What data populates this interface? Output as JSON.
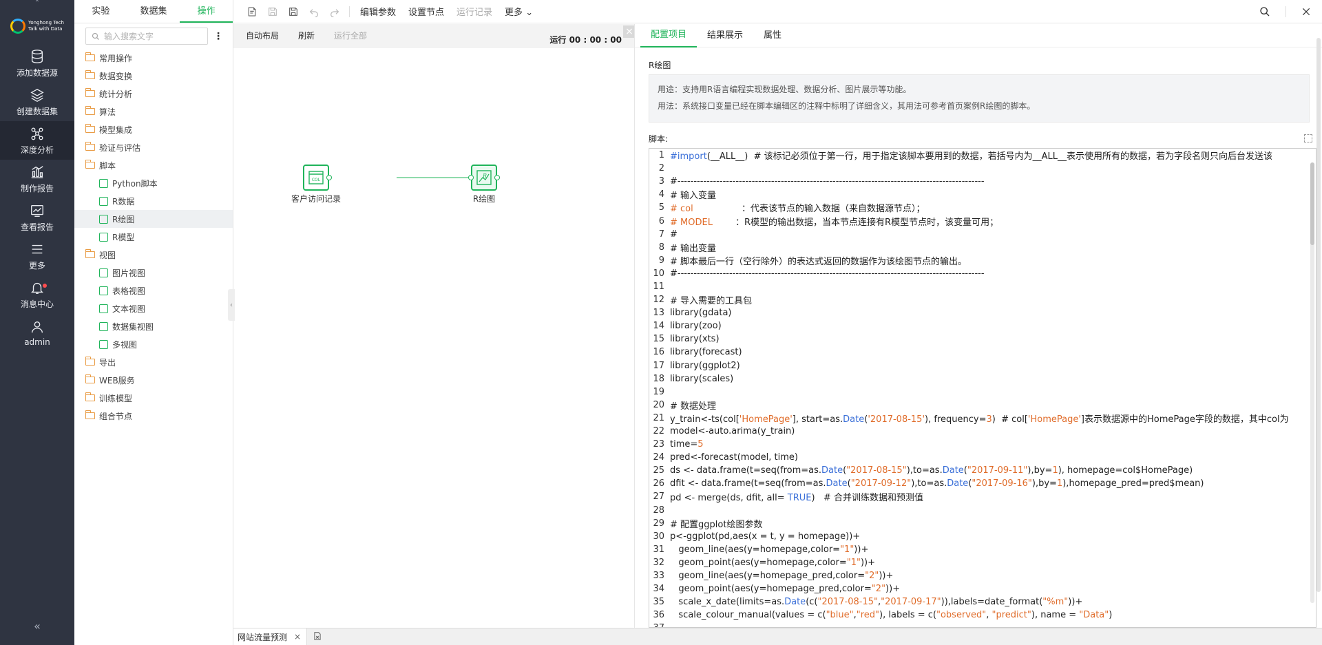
{
  "nav": {
    "items": [
      {
        "label": "添加数据源",
        "icon": "database-icon"
      },
      {
        "label": "创建数据集",
        "icon": "layers-icon"
      },
      {
        "label": "深度分析",
        "icon": "network-icon"
      },
      {
        "label": "制作报告",
        "icon": "bar-chart-icon"
      },
      {
        "label": "查看报告",
        "icon": "line-chart-icon"
      },
      {
        "label": "更多",
        "icon": "menu-icon"
      },
      {
        "label": "消息中心",
        "icon": "bell-icon"
      },
      {
        "label": "admin",
        "icon": "user-icon"
      }
    ],
    "brand_line1": "Yonghong Tech",
    "brand_line2": "Talk with Data"
  },
  "ops": {
    "tabs": [
      "实验",
      "数据集",
      "操作"
    ],
    "search_placeholder": "输入搜索文字",
    "tree": [
      {
        "label": "常用操作",
        "type": "folder"
      },
      {
        "label": "数据变换",
        "type": "folder"
      },
      {
        "label": "统计分析",
        "type": "folder"
      },
      {
        "label": "算法",
        "type": "folder"
      },
      {
        "label": "模型集成",
        "type": "folder"
      },
      {
        "label": "验证与评估",
        "type": "folder"
      },
      {
        "label": "脚本",
        "type": "folder"
      },
      {
        "label": "Python脚本",
        "type": "node"
      },
      {
        "label": "R数据",
        "type": "node"
      },
      {
        "label": "R绘图",
        "type": "node"
      },
      {
        "label": "R模型",
        "type": "node"
      },
      {
        "label": "视图",
        "type": "folder"
      },
      {
        "label": "图片视图",
        "type": "node"
      },
      {
        "label": "表格视图",
        "type": "node"
      },
      {
        "label": "文本视图",
        "type": "node"
      },
      {
        "label": "数据集视图",
        "type": "node"
      },
      {
        "label": "多视图",
        "type": "node"
      },
      {
        "label": "导出",
        "type": "folder"
      },
      {
        "label": "WEB服务",
        "type": "folder"
      },
      {
        "label": "训练模型",
        "type": "folder"
      },
      {
        "label": "组合节点",
        "type": "folder"
      }
    ]
  },
  "toolbar": {
    "edit_params": "编辑参数",
    "set_node": "设置节点",
    "run_log": "运行记录",
    "more": "更多"
  },
  "canvas": {
    "auto_layout": "自动布局",
    "refresh": "刷新",
    "run_all": "运行全部",
    "run_time": "运行 00 : 00 : 00",
    "node1_label": "客户访问记录",
    "node1_icon_text": "COL",
    "node2_label": "R绘图",
    "node2_icon_text": "R"
  },
  "bottom": {
    "tab_label": "网站流量预测"
  },
  "right": {
    "tabs": [
      "配置项目",
      "结果展示",
      "属性"
    ],
    "section_title": "R绘图",
    "usage1": "用途：支持用R语言编程实现数据处理、数据分析、图片展示等功能。",
    "usage2": "用法：系统接口变量已经在脚本编辑区的注释中标明了详细含义，其用法可参考首页案例R绘图的脚本。",
    "script_label": "脚本:"
  },
  "code_lines": [
    [
      [
        "kw",
        "#import"
      ],
      [
        "t",
        "(__ALL__)  # 该标记必须位于第一行，用于指定该脚本要用到的数据，若括号内为__ALL__表示使用所有的数据，若为字段名则只向后台发送该"
      ]
    ],
    [],
    [
      [
        "t",
        "#-----------------------------------------------------------------------------------------------"
      ]
    ],
    [
      [
        "t",
        "# 输入变量"
      ]
    ],
    [
      [
        "str",
        "# col"
      ],
      [
        "t",
        "                 ：代表该节点的输入数据（来自数据源节点）；"
      ]
    ],
    [
      [
        "str",
        "# MODEL"
      ],
      [
        "t",
        "        ：R模型的输出数据，当本节点连接有R模型节点时，该变量可用；"
      ]
    ],
    [
      [
        "t",
        "#"
      ]
    ],
    [
      [
        "t",
        "# 输出变量"
      ]
    ],
    [
      [
        "t",
        "# 脚本最后一行（空行除外）的表达式返回的数据作为该绘图节点的输出。"
      ]
    ],
    [
      [
        "t",
        "#-----------------------------------------------------------------------------------------------"
      ]
    ],
    [],
    [
      [
        "t",
        "# 导入需要的工具包"
      ]
    ],
    [
      [
        "t",
        "library(gdata)"
      ]
    ],
    [
      [
        "t",
        "library(zoo)"
      ]
    ],
    [
      [
        "t",
        "library(xts)"
      ]
    ],
    [
      [
        "t",
        "library(forecast)"
      ]
    ],
    [
      [
        "t",
        "library(ggplot2)"
      ]
    ],
    [
      [
        "t",
        "library(scales)"
      ]
    ],
    [],
    [
      [
        "t",
        "# 数据处理"
      ]
    ],
    [
      [
        "t",
        "y_train<-ts(col["
      ],
      [
        "str",
        "'HomePage'"
      ],
      [
        "t",
        "], start=as."
      ],
      [
        "kw",
        "Date"
      ],
      [
        "t",
        "("
      ],
      [
        "str",
        "'2017-08-15'"
      ],
      [
        "t",
        "), frequency="
      ],
      [
        "num",
        "3"
      ],
      [
        "t",
        ")  # col["
      ],
      [
        "str",
        "'HomePage'"
      ],
      [
        "t",
        "]表示数据源中的HomePage字段的数据，其中col为"
      ]
    ],
    [
      [
        "t",
        "model<-auto.arima(y_train)"
      ]
    ],
    [
      [
        "t",
        "time="
      ],
      [
        "num",
        "5"
      ]
    ],
    [
      [
        "t",
        "pred<-forecast(model, time)"
      ]
    ],
    [
      [
        "t",
        "ds <- data.frame(t=seq(from=as."
      ],
      [
        "kw",
        "Date"
      ],
      [
        "t",
        "("
      ],
      [
        "str",
        "\"2017-08-15\""
      ],
      [
        "t",
        "),to=as."
      ],
      [
        "kw",
        "Date"
      ],
      [
        "t",
        "("
      ],
      [
        "str",
        "\"2017-09-11\""
      ],
      [
        "t",
        "),by="
      ],
      [
        "num",
        "1"
      ],
      [
        "t",
        "), homepage=col$HomePage)"
      ]
    ],
    [
      [
        "t",
        "dfit <- data.frame(t=seq(from=as."
      ],
      [
        "kw",
        "Date"
      ],
      [
        "t",
        "("
      ],
      [
        "str",
        "\"2017-09-12\""
      ],
      [
        "t",
        "),to=as."
      ],
      [
        "kw",
        "Date"
      ],
      [
        "t",
        "("
      ],
      [
        "str",
        "\"2017-09-16\""
      ],
      [
        "t",
        "),by="
      ],
      [
        "num",
        "1"
      ],
      [
        "t",
        "),homepage_pred=pred$mean)"
      ]
    ],
    [
      [
        "t",
        "pd <- merge(ds, dfit, all= "
      ],
      [
        "kw",
        "TRUE"
      ],
      [
        "t",
        ")   # 合并训练数据和预测值"
      ]
    ],
    [],
    [
      [
        "t",
        "# 配置ggplot绘图参数"
      ]
    ],
    [
      [
        "t",
        "p<-ggplot(pd,aes(x = t, y = homepage))+"
      ]
    ],
    [
      [
        "t",
        "   geom_line(aes(y=homepage,color="
      ],
      [
        "str",
        "\"1\""
      ],
      [
        "t",
        "))+"
      ]
    ],
    [
      [
        "t",
        "   geom_point(aes(y=homepage,color="
      ],
      [
        "str",
        "\"1\""
      ],
      [
        "t",
        "))+"
      ]
    ],
    [
      [
        "t",
        "   geom_line(aes(y=homepage_pred,color="
      ],
      [
        "str",
        "\"2\""
      ],
      [
        "t",
        "))+"
      ]
    ],
    [
      [
        "t",
        "   geom_point(aes(y=homepage_pred,color="
      ],
      [
        "str",
        "\"2\""
      ],
      [
        "t",
        "))+"
      ]
    ],
    [
      [
        "t",
        "   scale_x_date(limits=as."
      ],
      [
        "kw",
        "Date"
      ],
      [
        "t",
        "(c("
      ],
      [
        "str",
        "\"2017-08-15\""
      ],
      [
        "t",
        ","
      ],
      [
        "str",
        "\"2017-09-17\""
      ],
      [
        "t",
        ")),labels=date_format("
      ],
      [
        "str",
        "\"%m\""
      ],
      [
        "t",
        "))+"
      ]
    ],
    [
      [
        "t",
        "   scale_colour_manual(values = c("
      ],
      [
        "str",
        "\"blue\""
      ],
      [
        "t",
        ","
      ],
      [
        "str",
        "\"red\""
      ],
      [
        "t",
        "), labels = c("
      ],
      [
        "str",
        "\"observed\""
      ],
      [
        "t",
        ", "
      ],
      [
        "str",
        "\"predict\""
      ],
      [
        "t",
        "), name = "
      ],
      [
        "str",
        "\"Data\""
      ],
      [
        "t",
        ")"
      ]
    ],
    []
  ]
}
